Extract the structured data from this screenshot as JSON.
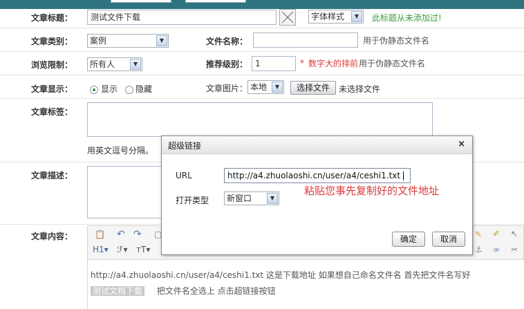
{
  "form": {
    "title_label": "文章标题：",
    "title_value": "测试文件下载",
    "font_style": "字体样式",
    "title_hint": "此标题从未添加过!",
    "category_label": "文章类别：",
    "category_value": "案例",
    "filename_label": "文件名称：",
    "filename_value": "",
    "filename_hint": "用于伪静态文件名",
    "browse_label": "浏览限制：",
    "browse_value": "所有人",
    "level_label": "推荐级别：",
    "level_value": "1",
    "level_star": "*",
    "level_hint_red": "数字大的排前",
    "level_hint": "用于伪静态文件名",
    "display_label": "文章显示：",
    "display_show": "显示",
    "display_hide": "隐藏",
    "image_label": "文章图片：",
    "image_source": "本地",
    "choose_file": "选择文件",
    "no_file": "未选择文件",
    "tags_label": "文章标签：",
    "tags_hint": "用英文逗号分隔。",
    "desc_label": "文章描述：",
    "content_label": "文章内容："
  },
  "editor": {
    "line1": "http://a4.zhuolaoshi.cn/user/a4/ceshi1.txt  这是下载地址 如果想自己命名文件名 首先把文件名写好",
    "selected": "测试文档下载",
    "line2": "把文件名全选上  点击超链接按钮",
    "heading_tool": "H1",
    "font_tool": "ℱ",
    "size_tool": "тT"
  },
  "dialog": {
    "title": "超级链接",
    "close": "×",
    "url_label": "URL",
    "url_value": "http://a4.zhuolaoshi.cn/user/a4/ceshi1.txt",
    "annotation": "粘贴您事先复制好的文件地址",
    "open_type_label": "打开类型",
    "open_type_value": "新窗口",
    "ok": "确定",
    "cancel": "取消"
  },
  "colors": {
    "topbar": "#2f7280",
    "hint_green": "#3a9b3a",
    "hint_red": "#e03a3a"
  }
}
